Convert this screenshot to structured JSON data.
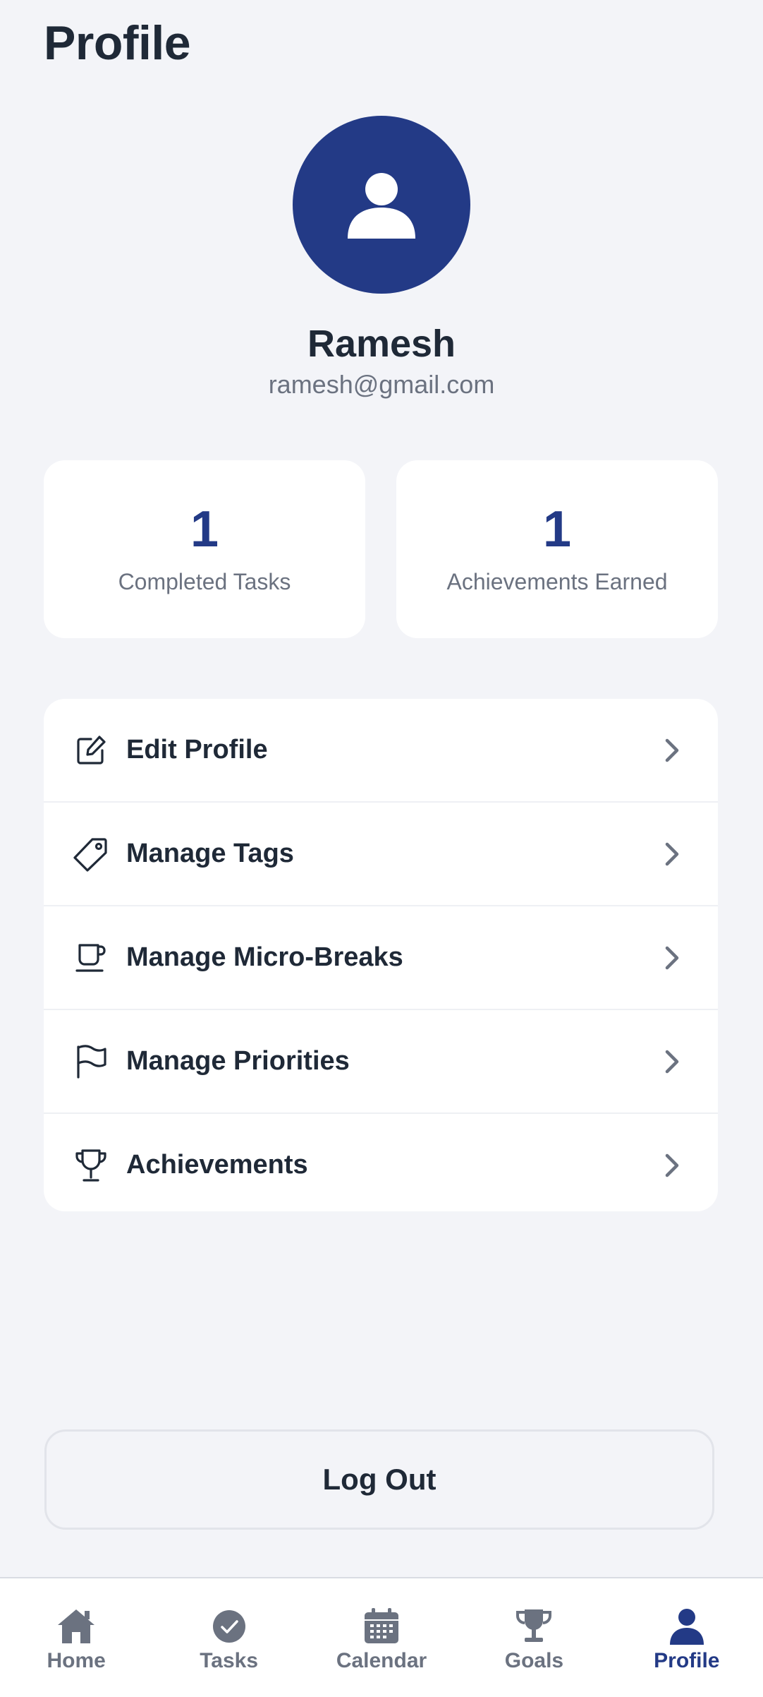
{
  "header": {
    "title": "Profile"
  },
  "user": {
    "name": "Ramesh",
    "email": "ramesh@gmail.com",
    "avatar_icon": "user-icon",
    "avatar_color": "#233a86"
  },
  "stats": [
    {
      "value": "1",
      "label": "Completed Tasks"
    },
    {
      "value": "1",
      "label": "Achievements Earned"
    }
  ],
  "menu": [
    {
      "label": "Edit Profile",
      "icon": "edit-icon"
    },
    {
      "label": "Manage Tags",
      "icon": "tag-icon"
    },
    {
      "label": "Manage Micro-Breaks",
      "icon": "cup-icon"
    },
    {
      "label": "Manage Priorities",
      "icon": "flag-icon"
    },
    {
      "label": "Achievements",
      "icon": "trophy-icon"
    }
  ],
  "logout": {
    "label": "Log Out"
  },
  "nav": {
    "active": "Profile",
    "items": [
      {
        "label": "Home",
        "icon": "home-icon"
      },
      {
        "label": "Tasks",
        "icon": "check-circle-icon"
      },
      {
        "label": "Calendar",
        "icon": "calendar-icon"
      },
      {
        "label": "Goals",
        "icon": "trophy-icon"
      },
      {
        "label": "Profile",
        "icon": "person-icon"
      }
    ]
  },
  "colors": {
    "accent": "#233a86",
    "background": "#f3f4f8",
    "text": "#1f2937",
    "muted": "#6b7280"
  }
}
